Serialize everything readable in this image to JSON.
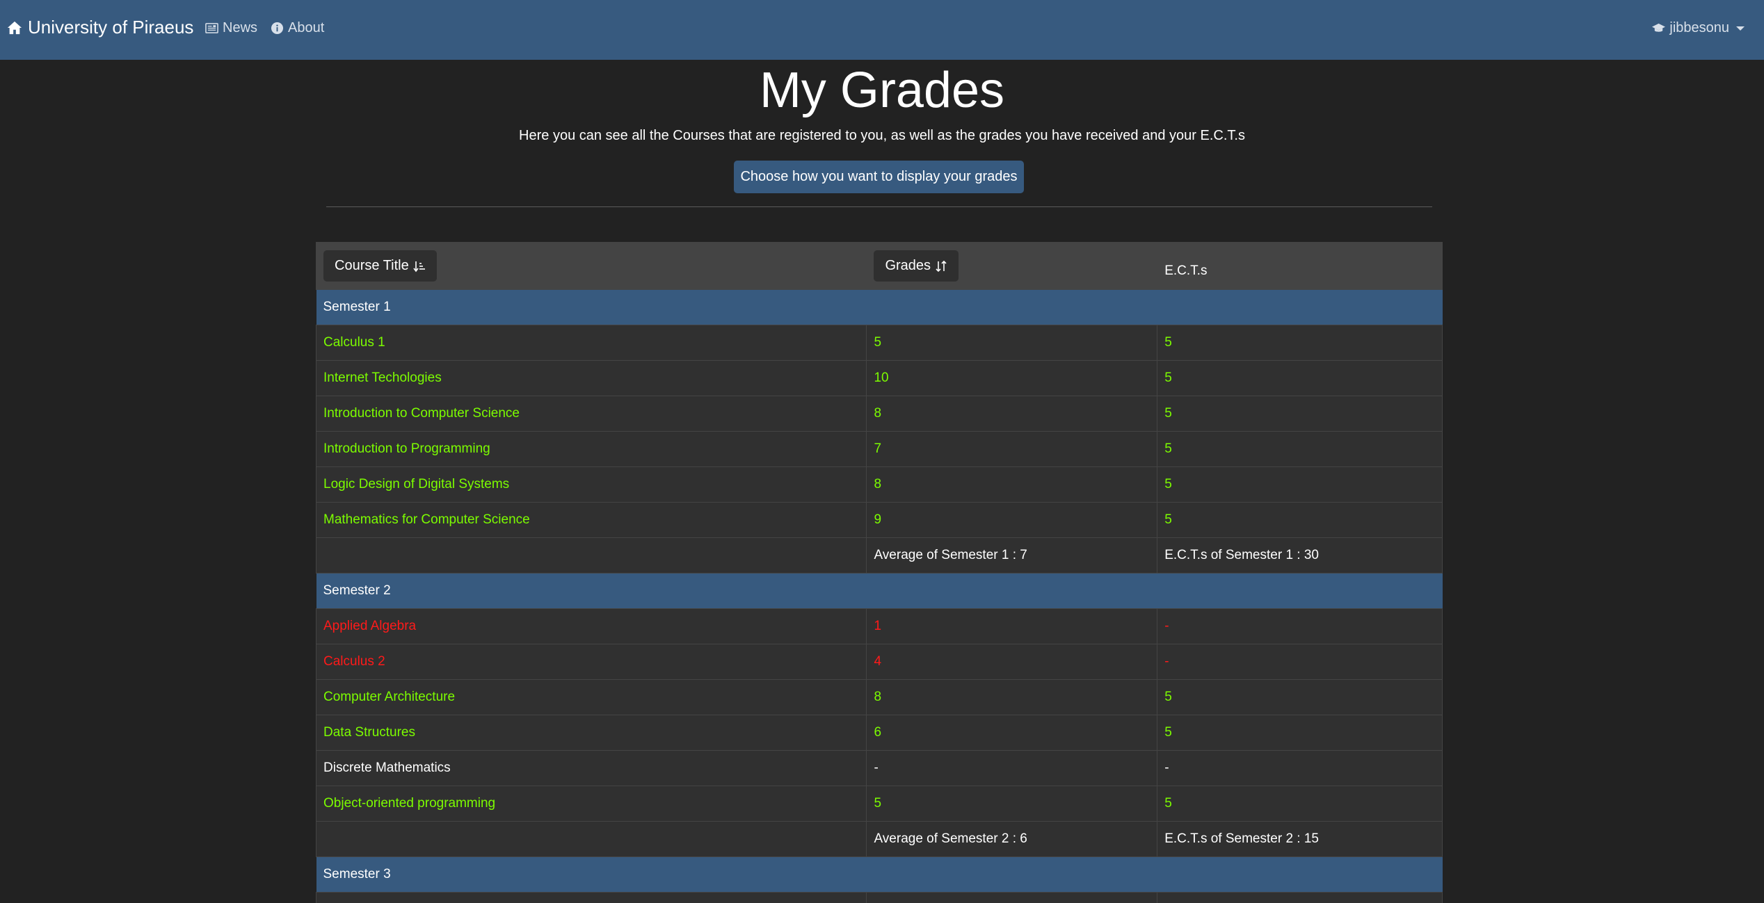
{
  "navbar": {
    "brand": "University of Piraeus",
    "news": "News",
    "about": "About",
    "user": "jibbesonu"
  },
  "header": {
    "title": "My Grades",
    "subtitle": "Here you can see all the Courses that are registered to you, as well as the grades you have received and your E.C.T.s",
    "display_button": "Choose how you want to display your grades"
  },
  "table": {
    "col_title": "Course Title",
    "col_grades": "Grades",
    "col_ects": "E.C.T.s"
  },
  "semesters": [
    {
      "label": "Semester 1",
      "courses": [
        {
          "title": "Calculus 1",
          "grade": "5",
          "ects": "5",
          "status": "pass"
        },
        {
          "title": "Internet Techologies",
          "grade": "10",
          "ects": "5",
          "status": "pass"
        },
        {
          "title": "Introduction to Computer Science",
          "grade": "8",
          "ects": "5",
          "status": "pass"
        },
        {
          "title": "Introduction to Programming",
          "grade": "7",
          "ects": "5",
          "status": "pass"
        },
        {
          "title": "Logic Design of Digital Systems",
          "grade": "8",
          "ects": "5",
          "status": "pass"
        },
        {
          "title": "Mathematics for Computer Science",
          "grade": "9",
          "ects": "5",
          "status": "pass"
        }
      ],
      "average": "Average of Semester 1 : 7",
      "ects_total": "E.C.T.s of Semester 1 : 30"
    },
    {
      "label": "Semester 2",
      "courses": [
        {
          "title": "Applied Algebra",
          "grade": "1",
          "ects": "-",
          "status": "fail"
        },
        {
          "title": "Calculus 2",
          "grade": "4",
          "ects": "-",
          "status": "fail"
        },
        {
          "title": "Computer Architecture",
          "grade": "8",
          "ects": "5",
          "status": "pass"
        },
        {
          "title": "Data Structures",
          "grade": "6",
          "ects": "5",
          "status": "pass"
        },
        {
          "title": "Discrete Mathematics",
          "grade": "-",
          "ects": "-",
          "status": "neutral"
        },
        {
          "title": "Object-oriented programming",
          "grade": "5",
          "ects": "5",
          "status": "pass"
        }
      ],
      "average": "Average of Semester 2 : 6",
      "ects_total": "E.C.T.s of Semester 2 : 15"
    },
    {
      "label": "Semester 3",
      "courses": [],
      "average": "",
      "ects_total": ""
    }
  ],
  "colors": {
    "navbar": "#375a7f",
    "background": "#222222",
    "pass": "#7cfc00",
    "fail": "#ff1a1a"
  }
}
